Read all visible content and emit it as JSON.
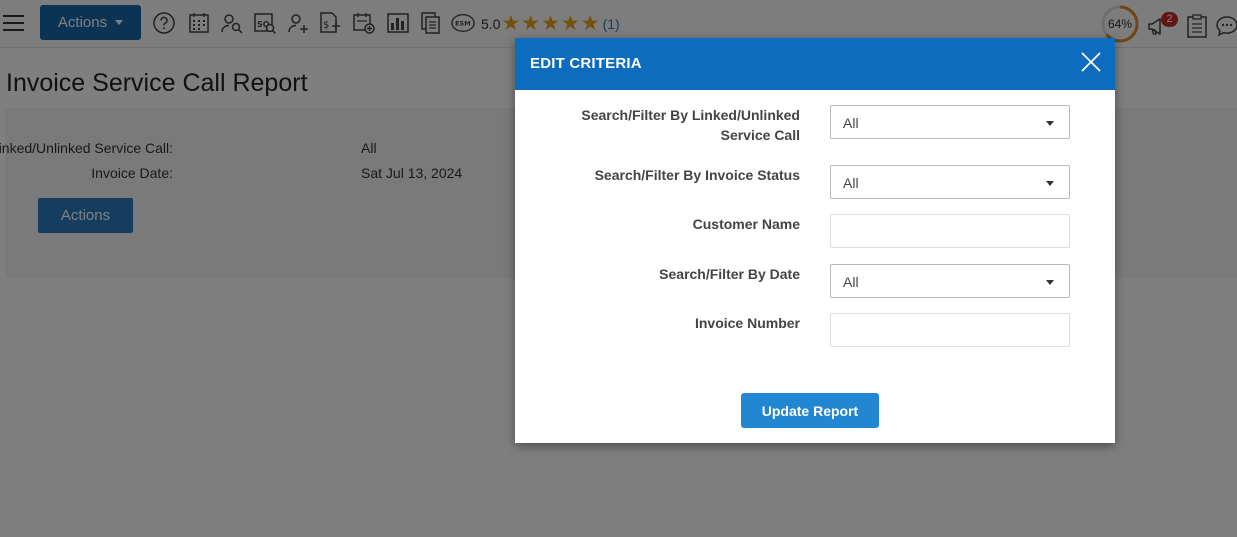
{
  "topbar": {
    "actions_label": "Actions",
    "icons": [
      "help-icon",
      "calendar-icon",
      "user-search-icon",
      "sq-search-icon",
      "add-user-icon",
      "add-invoice-icon",
      "calendar-add-icon",
      "bar-chart-icon",
      "documents-icon",
      "esm-icon"
    ],
    "esm_label": "ESM",
    "rating_value": "5.0",
    "rating_stars": 5,
    "rating_count": "(1)",
    "progress_percent": "64%",
    "progress_fraction": 0.64,
    "notification_count": "2",
    "colors": {
      "accent": "#1566a8",
      "star": "#e9a51c",
      "progress": "#e08a2c",
      "badge": "#c62828"
    }
  },
  "page": {
    "title": "Invoice Service Call Report",
    "criteria": [
      {
        "label": "Linked/Unlinked Service Call:",
        "value": "All"
      },
      {
        "label": "Invoice Date:",
        "value": "Sat Jul 13, 2024"
      }
    ],
    "actions_label": "Actions"
  },
  "modal": {
    "title": "EDIT CRITERIA",
    "fields": {
      "linked_filter": {
        "label": "Search/Filter By Linked/Unlinked Service Call",
        "value": "All"
      },
      "status_filter": {
        "label": "Search/Filter By Invoice Status",
        "value": "All"
      },
      "customer_name": {
        "label": "Customer Name",
        "value": "",
        "placeholder": ""
      },
      "date_filter": {
        "label": "Search/Filter By Date",
        "value": "All"
      },
      "invoice_number": {
        "label": "Invoice Number",
        "value": "",
        "placeholder": ""
      }
    },
    "update_label": "Update Report",
    "colors": {
      "header": "#0d6cbd",
      "button": "#2287d3"
    }
  }
}
